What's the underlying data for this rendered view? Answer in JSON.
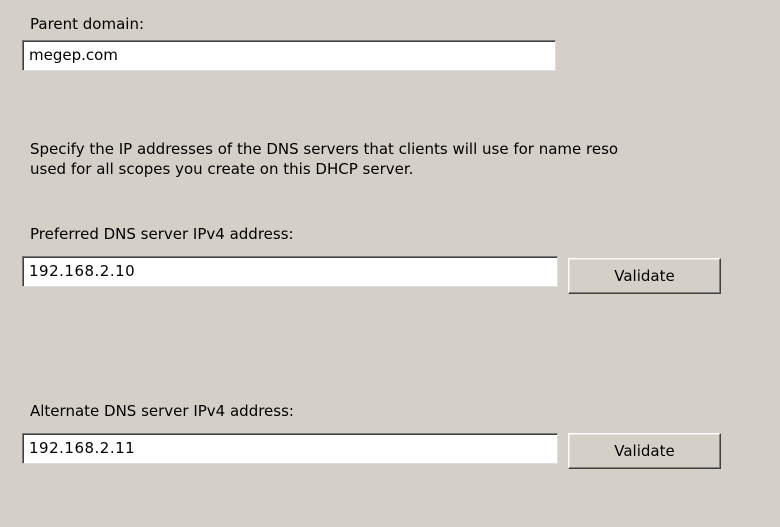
{
  "parent_domain": {
    "label": "Parent domain:",
    "value": "megep.com"
  },
  "description": {
    "line1": "Specify the IP addresses of the DNS servers that clients will use for name reso",
    "line2": "used for all scopes you create on this DHCP server."
  },
  "preferred_dns": {
    "label": "Preferred DNS server IPv4 address:",
    "value": "192.168.2.10",
    "button_label": "Validate"
  },
  "alternate_dns": {
    "label": "Alternate DNS server IPv4 address:",
    "value": "192.168.2.11",
    "button_label": "Validate"
  }
}
